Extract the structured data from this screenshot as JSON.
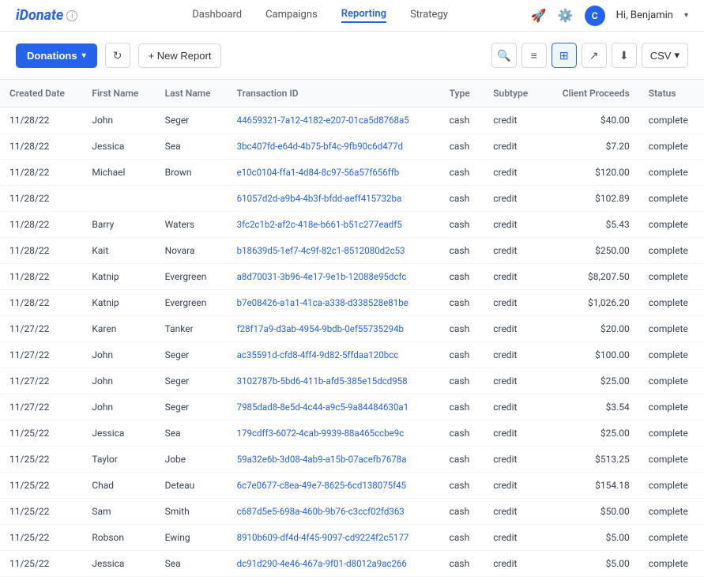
{
  "app": {
    "logo": "iDonate",
    "logo_i": "i",
    "logo_rest": "Donate"
  },
  "nav": {
    "links": [
      {
        "label": "Dashboard",
        "active": false
      },
      {
        "label": "Campaigns",
        "active": false
      },
      {
        "label": "Reporting",
        "active": true
      },
      {
        "label": "Strategy",
        "active": false
      }
    ],
    "user": "Hi, Benjamin",
    "avatar_letter": "C"
  },
  "toolbar": {
    "donations_label": "Donations",
    "new_report_label": "+ New Report",
    "csv_label": "CSV"
  },
  "table": {
    "headers": [
      "Created Date",
      "First Name",
      "Last Name",
      "Transaction ID",
      "Type",
      "Subtype",
      "Client Proceeds",
      "Status"
    ],
    "rows": [
      {
        "date": "11/28/22",
        "first": "John",
        "last": "Seger",
        "txn": "44659321-7a12-4182-e207-01ca5d8768a5",
        "type": "cash",
        "subtype": "credit",
        "amount": "$40.00",
        "status": "complete"
      },
      {
        "date": "11/28/22",
        "first": "Jessica",
        "last": "Sea",
        "txn": "3bc407fd-e64d-4b75-bf4c-9fb90c6d477d",
        "type": "cash",
        "subtype": "credit",
        "amount": "$7.20",
        "status": "complete"
      },
      {
        "date": "11/28/22",
        "first": "Michael",
        "last": "Brown",
        "txn": "e10c0104-ffa1-4d84-8c97-56a57f656ffb",
        "type": "cash",
        "subtype": "credit",
        "amount": "$120.00",
        "status": "complete"
      },
      {
        "date": "11/28/22",
        "first": "",
        "last": "",
        "txn": "61057d2d-a9b4-4b3f-bfdd-aeff415732ba",
        "type": "cash",
        "subtype": "credit",
        "amount": "$102.89",
        "status": "complete"
      },
      {
        "date": "11/28/22",
        "first": "Barry",
        "last": "Waters",
        "txn": "3fc2c1b2-af2c-418e-b661-b51c277eadf5",
        "type": "cash",
        "subtype": "credit",
        "amount": "$5.43",
        "status": "complete"
      },
      {
        "date": "11/28/22",
        "first": "Kait",
        "last": "Novara",
        "txn": "b18639d5-1ef7-4c9f-82c1-8512080d2c53",
        "type": "cash",
        "subtype": "credit",
        "amount": "$250.00",
        "status": "complete"
      },
      {
        "date": "11/28/22",
        "first": "Katnip",
        "last": "Evergreen",
        "txn": "a8d70031-3b96-4e17-9e1b-12088e95dcfc",
        "type": "cash",
        "subtype": "credit",
        "amount": "$8,207.50",
        "status": "complete"
      },
      {
        "date": "11/28/22",
        "first": "Katnip",
        "last": "Evergreen",
        "txn": "b7e08426-a1a1-41ca-a338-d338528e81be",
        "type": "cash",
        "subtype": "credit",
        "amount": "$1,026.20",
        "status": "complete"
      },
      {
        "date": "11/27/22",
        "first": "Karen",
        "last": "Tanker",
        "txn": "f28f17a9-d3ab-4954-9bdb-0ef55735294b",
        "type": "cash",
        "subtype": "credit",
        "amount": "$20.00",
        "status": "complete"
      },
      {
        "date": "11/27/22",
        "first": "John",
        "last": "Seger",
        "txn": "ac35591d-cfd8-4ff4-9d82-5ffdaa120bcc",
        "type": "cash",
        "subtype": "credit",
        "amount": "$100.00",
        "status": "complete"
      },
      {
        "date": "11/27/22",
        "first": "John",
        "last": "Seger",
        "txn": "3102787b-5bd6-411b-afd5-385e15dcd958",
        "type": "cash",
        "subtype": "credit",
        "amount": "$25.00",
        "status": "complete"
      },
      {
        "date": "11/27/22",
        "first": "John",
        "last": "Seger",
        "txn": "7985dad8-8e5d-4c44-a9c5-9a84484630a1",
        "type": "cash",
        "subtype": "credit",
        "amount": "$3.54",
        "status": "complete"
      },
      {
        "date": "11/25/22",
        "first": "Jessica",
        "last": "Sea",
        "txn": "179cdff3-6072-4cab-9939-88a465ccbe9c",
        "type": "cash",
        "subtype": "credit",
        "amount": "$25.00",
        "status": "complete"
      },
      {
        "date": "11/25/22",
        "first": "Taylor",
        "last": "Jobe",
        "txn": "59a32e6b-3d08-4ab9-a15b-07acefb7678a",
        "type": "cash",
        "subtype": "credit",
        "amount": "$513.25",
        "status": "complete"
      },
      {
        "date": "11/25/22",
        "first": "Chad",
        "last": "Deteau",
        "txn": "6c7e0677-c8ea-49e7-8625-6cd138075f45",
        "type": "cash",
        "subtype": "credit",
        "amount": "$154.18",
        "status": "complete"
      },
      {
        "date": "11/25/22",
        "first": "Sam",
        "last": "Smith",
        "txn": "c687d5e5-698a-460b-9b76-c3ccf02fd363",
        "type": "cash",
        "subtype": "credit",
        "amount": "$50.00",
        "status": "complete"
      },
      {
        "date": "11/25/22",
        "first": "Robson",
        "last": "Ewing",
        "txn": "8910b609-df4d-4f45-9097-cd9224f2c5177",
        "type": "cash",
        "subtype": "credit",
        "amount": "$5.00",
        "status": "complete"
      },
      {
        "date": "11/25/22",
        "first": "Jessica",
        "last": "Sea",
        "txn": "dc91d290-4e46-467a-9f01-d8012a9ac266",
        "type": "cash",
        "subtype": "credit",
        "amount": "$5.00",
        "status": "complete"
      }
    ]
  }
}
